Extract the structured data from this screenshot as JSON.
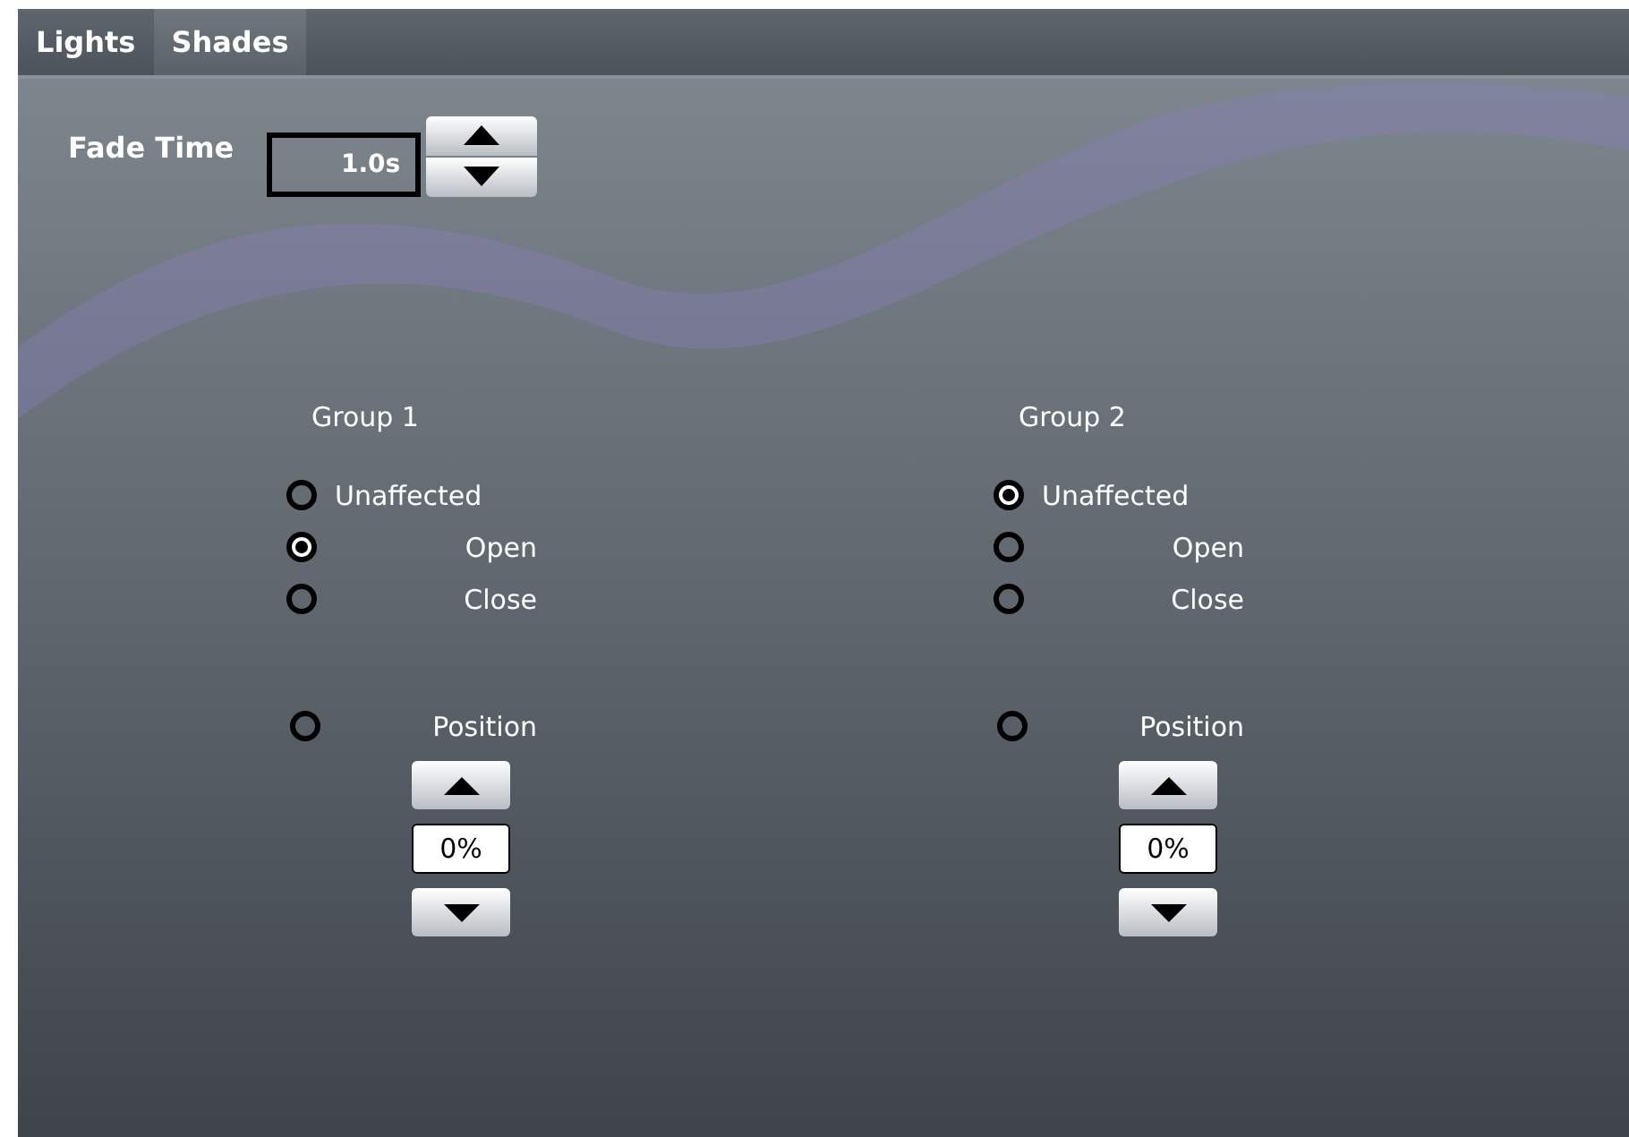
{
  "tabs": [
    {
      "label": "Lights",
      "selected": false
    },
    {
      "label": "Shades",
      "selected": true
    }
  ],
  "fade_time": {
    "label": "Fade Time",
    "value": "1.0s"
  },
  "groups": [
    {
      "title": "Group 1",
      "options": [
        {
          "label": "Unaffected",
          "selected": false
        },
        {
          "label": "Open",
          "selected": true
        },
        {
          "label": "Close",
          "selected": false
        }
      ],
      "position": {
        "label": "Position",
        "selected": false,
        "value": "0%"
      }
    },
    {
      "title": "Group 2",
      "options": [
        {
          "label": "Unaffected",
          "selected": true
        },
        {
          "label": "Open",
          "selected": false
        },
        {
          "label": "Close",
          "selected": false
        }
      ],
      "position": {
        "label": "Position",
        "selected": false,
        "value": "0%"
      }
    }
  ]
}
